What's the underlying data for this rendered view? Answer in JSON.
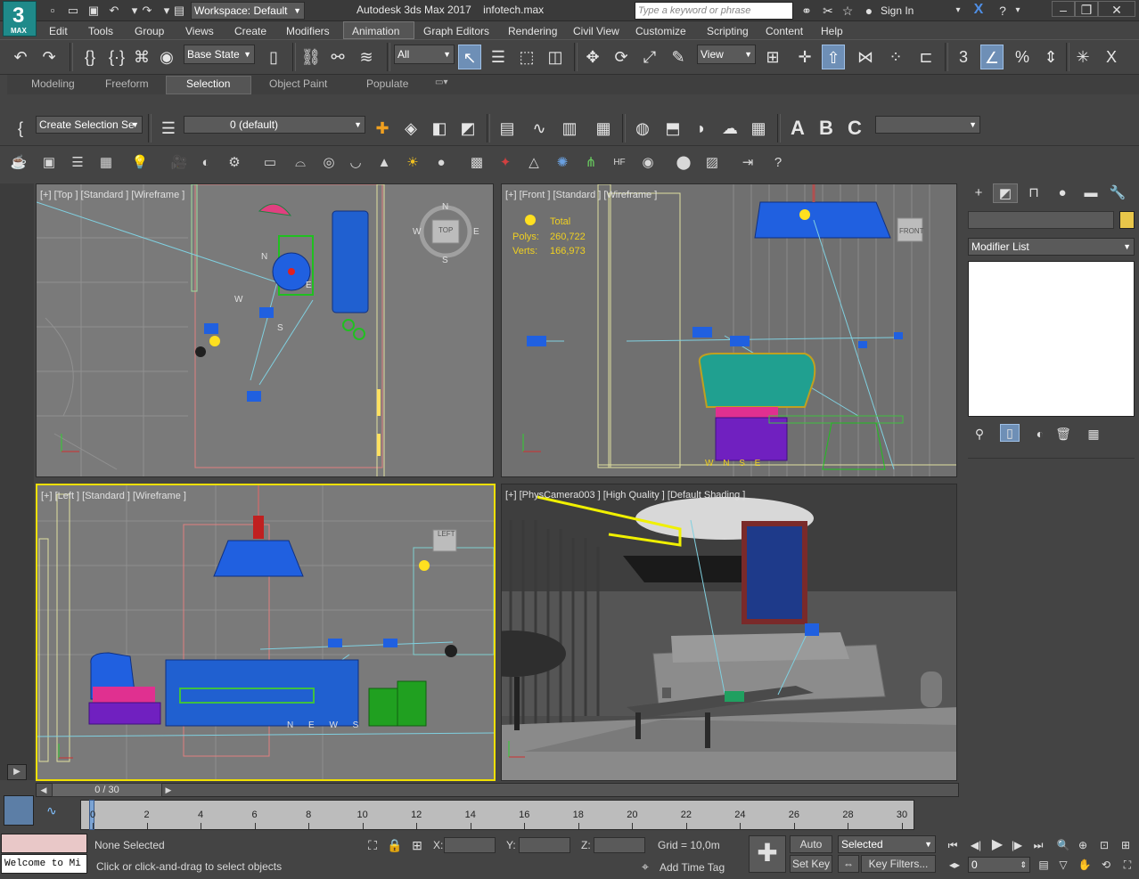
{
  "window": {
    "app_name": "Autodesk 3ds Max 2017",
    "file_name": "infotech.max",
    "logo_number": "3",
    "logo_text": "MAX",
    "workspace_label": "Workspace: Default",
    "search_placeholder": "Type a keyword or phrase",
    "sign_in": "Sign In"
  },
  "menubar": {
    "items": [
      "Edit",
      "Tools",
      "Group",
      "Views",
      "Create",
      "Modifiers",
      "Animation",
      "Graph Editors",
      "Rendering",
      "Civil View",
      "Customize",
      "Scripting",
      "Content",
      "Help"
    ]
  },
  "main_toolbar": {
    "state_set": "Base State",
    "filter": "All",
    "ref_coord": "View"
  },
  "ribbon": {
    "tabs": [
      "Modeling",
      "Freeform",
      "Selection",
      "Object Paint",
      "Populate"
    ],
    "active_tab": "Selection"
  },
  "toolbar2": {
    "selection_set": "Create Selection Se",
    "layer": "0 (default)"
  },
  "viewports": {
    "top": {
      "label": "[+] [Top ] [Standard ] [Wireframe ]",
      "viewcube": "TOP",
      "compass": {
        "n": "N",
        "s": "S",
        "e": "E",
        "w": "W"
      }
    },
    "front": {
      "label": "[+] [Front ] [Standard ] [Wireframe ]",
      "viewcube": "FRONT",
      "stats": {
        "total_label": "Total",
        "polys_label": "Polys:",
        "polys_value": "260,722",
        "verts_label": "Verts:",
        "verts_value": "166,973"
      },
      "compass_text": "W N S E"
    },
    "left": {
      "label": "[+] [Left ] [Standard ] [Wireframe ]",
      "viewcube": "LEFT",
      "compass_text": "N E W S"
    },
    "camera": {
      "label": "[+] [PhysCamera003 ] [High Quality ] [Default Shading ]"
    }
  },
  "command_panel": {
    "modifier_list": "Modifier List",
    "colors": {
      "object_color": "#e8c64a"
    }
  },
  "timeline": {
    "frame_display": "0 / 30",
    "ticks": [
      "0",
      "2",
      "4",
      "6",
      "8",
      "10",
      "12",
      "14",
      "16",
      "18",
      "20",
      "22",
      "24",
      "26",
      "28",
      "30"
    ]
  },
  "statusbar": {
    "maxscript_text": "Welcome to Mi",
    "selection_status": "None Selected",
    "prompt": "Click or click-and-drag to select objects",
    "x_label": "X:",
    "y_label": "Y:",
    "z_label": "Z:",
    "grid": "Grid = 10,0m",
    "add_time_tag": "Add Time Tag",
    "auto_key": "Auto Key",
    "set_key": "Set Key",
    "selected_combo": "Selected",
    "key_filters": "Key Filters...",
    "frame_field": "0"
  }
}
